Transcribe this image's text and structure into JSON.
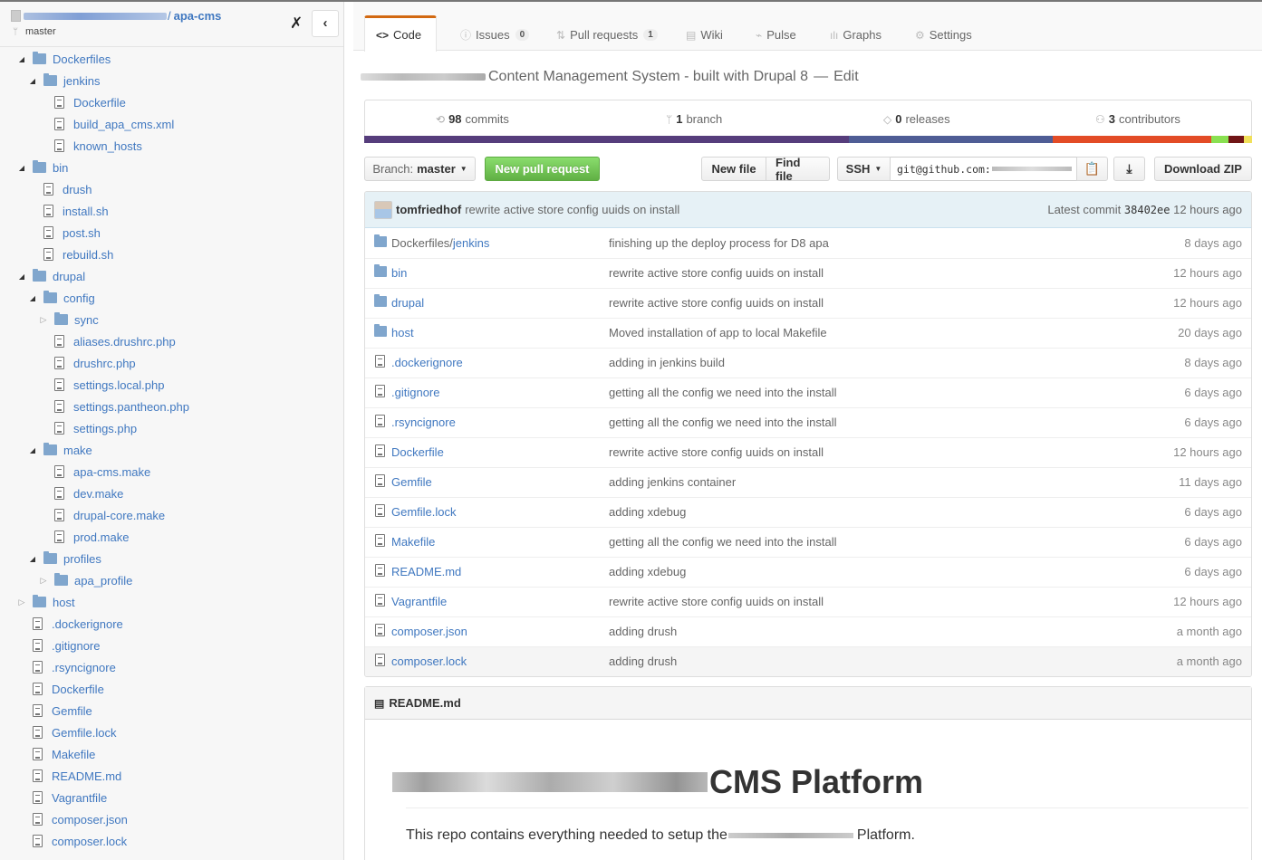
{
  "sidebar": {
    "repo_name": "apa-cms",
    "branch": "master",
    "tree": [
      {
        "label": "Dockerfiles",
        "type": "folder",
        "depth": 0,
        "state": "open"
      },
      {
        "label": "jenkins",
        "type": "folder",
        "depth": 1,
        "state": "open"
      },
      {
        "label": "Dockerfile",
        "type": "file",
        "depth": 2
      },
      {
        "label": "build_apa_cms.xml",
        "type": "file",
        "depth": 2
      },
      {
        "label": "known_hosts",
        "type": "file",
        "depth": 2
      },
      {
        "label": "bin",
        "type": "folder",
        "depth": 0,
        "state": "open"
      },
      {
        "label": "drush",
        "type": "file",
        "depth": 1
      },
      {
        "label": "install.sh",
        "type": "file",
        "depth": 1
      },
      {
        "label": "post.sh",
        "type": "file",
        "depth": 1
      },
      {
        "label": "rebuild.sh",
        "type": "file",
        "depth": 1
      },
      {
        "label": "drupal",
        "type": "folder",
        "depth": 0,
        "state": "open"
      },
      {
        "label": "config",
        "type": "folder",
        "depth": 1,
        "state": "open"
      },
      {
        "label": "sync",
        "type": "folder",
        "depth": 2,
        "state": "closed"
      },
      {
        "label": "aliases.drushrc.php",
        "type": "file",
        "depth": 2
      },
      {
        "label": "drushrc.php",
        "type": "file",
        "depth": 2
      },
      {
        "label": "settings.local.php",
        "type": "file",
        "depth": 2
      },
      {
        "label": "settings.pantheon.php",
        "type": "file",
        "depth": 2
      },
      {
        "label": "settings.php",
        "type": "file",
        "depth": 2
      },
      {
        "label": "make",
        "type": "folder",
        "depth": 1,
        "state": "open"
      },
      {
        "label": "apa-cms.make",
        "type": "file",
        "depth": 2
      },
      {
        "label": "dev.make",
        "type": "file",
        "depth": 2
      },
      {
        "label": "drupal-core.make",
        "type": "file",
        "depth": 2
      },
      {
        "label": "prod.make",
        "type": "file",
        "depth": 2
      },
      {
        "label": "profiles",
        "type": "folder",
        "depth": 1,
        "state": "open"
      },
      {
        "label": "apa_profile",
        "type": "folder",
        "depth": 2,
        "state": "closed"
      },
      {
        "label": "host",
        "type": "folder",
        "depth": 0,
        "state": "closed"
      },
      {
        "label": ".dockerignore",
        "type": "file",
        "depth": 0
      },
      {
        "label": ".gitignore",
        "type": "file",
        "depth": 0
      },
      {
        "label": ".rsyncignore",
        "type": "file",
        "depth": 0
      },
      {
        "label": "Dockerfile",
        "type": "file",
        "depth": 0
      },
      {
        "label": "Gemfile",
        "type": "file",
        "depth": 0
      },
      {
        "label": "Gemfile.lock",
        "type": "file",
        "depth": 0
      },
      {
        "label": "Makefile",
        "type": "file",
        "depth": 0
      },
      {
        "label": "README.md",
        "type": "file",
        "depth": 0
      },
      {
        "label": "Vagrantfile",
        "type": "file",
        "depth": 0
      },
      {
        "label": "composer.json",
        "type": "file",
        "depth": 0
      },
      {
        "label": "composer.lock",
        "type": "file",
        "depth": 0
      }
    ]
  },
  "tabs": [
    {
      "label": "Code",
      "icon": "code-icon",
      "glyph": "<>",
      "selected": true
    },
    {
      "label": "Issues",
      "icon": "issue-icon",
      "glyph": "ⓘ",
      "count": "0"
    },
    {
      "label": "Pull requests",
      "icon": "pull-request-icon",
      "glyph": "⇅",
      "count": "1"
    },
    {
      "label": "Wiki",
      "icon": "book-icon",
      "glyph": "▤"
    },
    {
      "label": "Pulse",
      "icon": "pulse-icon",
      "glyph": "⌁"
    },
    {
      "label": "Graphs",
      "icon": "graph-icon",
      "glyph": "ılı"
    },
    {
      "label": "Settings",
      "icon": "gear-icon",
      "glyph": "⚙"
    }
  ],
  "repo": {
    "description": "Content Management System - built with Drupal 8",
    "edit_separator": "—",
    "edit_label": "Edit"
  },
  "stats": {
    "commits": {
      "count": "98",
      "label": "commits"
    },
    "branches": {
      "count": "1",
      "label": "branch"
    },
    "releases": {
      "count": "0",
      "label": "releases"
    },
    "contributors": {
      "count": "3",
      "label": "contributors"
    }
  },
  "languages": [
    {
      "color": "#563d7c",
      "percent": 54.6
    },
    {
      "color": "#4f5d95",
      "percent": 23.0
    },
    {
      "color": "#e34c26",
      "percent": 17.8
    },
    {
      "color": "#89e051",
      "percent": 1.9
    },
    {
      "color": "#701516",
      "percent": 1.8
    },
    {
      "color": "#f1e05a",
      "percent": 0.9
    }
  ],
  "toolbar": {
    "branch_prefix": "Branch:",
    "branch_name": "master",
    "new_pull_request": "New pull request",
    "new_file": "New file",
    "find_file": "Find file",
    "protocol": "SSH",
    "clone_url": "git@github.com:",
    "download_zip": "Download ZIP"
  },
  "latest_commit": {
    "author": "tomfriedhof",
    "message": "rewrite active store config uuids on install",
    "prefix": "Latest commit",
    "sha": "38402ee",
    "age": "12 hours ago"
  },
  "files": [
    {
      "type": "folder",
      "dim": "Dockerfiles/",
      "name": "jenkins",
      "message": "finishing up the deploy process for D8 apa",
      "age": "8 days ago"
    },
    {
      "type": "folder",
      "dim": "",
      "name": "bin",
      "message": "rewrite active store config uuids on install",
      "age": "12 hours ago"
    },
    {
      "type": "folder",
      "dim": "",
      "name": "drupal",
      "message": "rewrite active store config uuids on install",
      "age": "12 hours ago"
    },
    {
      "type": "folder",
      "dim": "",
      "name": "host",
      "message": "Moved installation of app to local Makefile",
      "age": "20 days ago"
    },
    {
      "type": "file",
      "dim": "",
      "name": ".dockerignore",
      "message": "adding in jenkins build",
      "age": "8 days ago"
    },
    {
      "type": "file",
      "dim": "",
      "name": ".gitignore",
      "message": "getting all the config we need into the install",
      "age": "6 days ago"
    },
    {
      "type": "file",
      "dim": "",
      "name": ".rsyncignore",
      "message": "getting all the config we need into the install",
      "age": "6 days ago"
    },
    {
      "type": "file",
      "dim": "",
      "name": "Dockerfile",
      "message": "rewrite active store config uuids on install",
      "age": "12 hours ago"
    },
    {
      "type": "file",
      "dim": "",
      "name": "Gemfile",
      "message": "adding jenkins container",
      "age": "11 days ago"
    },
    {
      "type": "file",
      "dim": "",
      "name": "Gemfile.lock",
      "message": "adding xdebug",
      "age": "6 days ago"
    },
    {
      "type": "file",
      "dim": "",
      "name": "Makefile",
      "message": "getting all the config we need into the install",
      "age": "6 days ago"
    },
    {
      "type": "file",
      "dim": "",
      "name": "README.md",
      "message": "adding xdebug",
      "age": "6 days ago"
    },
    {
      "type": "file",
      "dim": "",
      "name": "Vagrantfile",
      "message": "rewrite active store config uuids on install",
      "age": "12 hours ago"
    },
    {
      "type": "file",
      "dim": "",
      "name": "composer.json",
      "message": "adding drush",
      "age": "a month ago"
    },
    {
      "type": "file",
      "dim": "",
      "name": "composer.lock",
      "message": "adding drush",
      "age": "a month ago",
      "hover": true
    }
  ],
  "readme": {
    "filename": "README.md",
    "heading": "CMS Platform",
    "paragraph_before": "This repo contains everything needed to setup the",
    "paragraph_after": "Platform."
  }
}
